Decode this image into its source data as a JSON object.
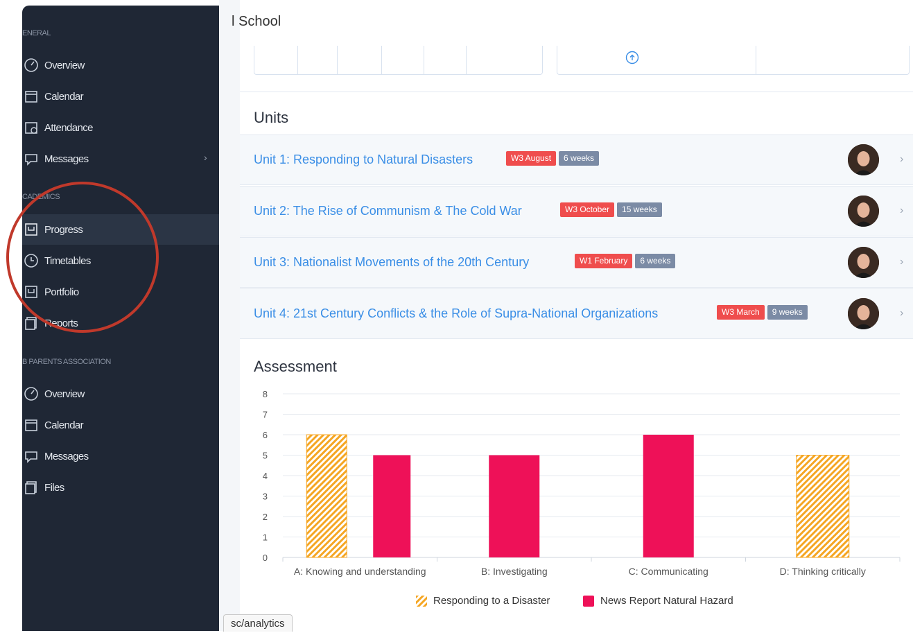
{
  "header": {
    "school_name": "l School"
  },
  "sidebar": {
    "sections": [
      {
        "label": "ENERAL"
      },
      {
        "label": "CADEMICS"
      },
      {
        "label": "B PARENTS ASSOCIATION"
      }
    ],
    "items": [
      {
        "label": "Overview",
        "icon": "overview-icon"
      },
      {
        "label": "Calendar",
        "icon": "calendar-icon"
      },
      {
        "label": "Attendance",
        "icon": "attendance-icon"
      },
      {
        "label": "Messages",
        "icon": "messages-icon"
      },
      {
        "label": "Progress",
        "icon": "progress-icon"
      },
      {
        "label": "Timetables",
        "icon": "clock-icon"
      },
      {
        "label": "Portfolio",
        "icon": "portfolio-icon"
      },
      {
        "label": "Reports",
        "icon": "reports-icon"
      },
      {
        "label": "Overview",
        "icon": "overview-icon"
      },
      {
        "label": "Calendar",
        "icon": "calendar-icon"
      },
      {
        "label": "Messages",
        "icon": "messages-icon"
      },
      {
        "label": "Files",
        "icon": "files-icon"
      }
    ],
    "active_item": "Progress",
    "messages_chevron": "›"
  },
  "units": {
    "heading": "Units",
    "items": [
      {
        "title": "Unit 1: Responding to Natural Disasters",
        "start": "W3 August",
        "duration": "6 weeks"
      },
      {
        "title": "Unit 2: The Rise of Communism & The Cold War",
        "start": "W3 October",
        "duration": "15 weeks"
      },
      {
        "title": "Unit 3: Nationalist Movements of the 20th Century",
        "start": "W1 February",
        "duration": "6 weeks"
      },
      {
        "title": "Unit 4: 21st Century Conflicts & the Role of Supra-National Organizations",
        "start": "W3 March",
        "duration": "9 weeks"
      }
    ],
    "chevron": "›"
  },
  "assessment": {
    "heading": "Assessment"
  },
  "chart_data": {
    "type": "bar",
    "title": "",
    "xlabel": "",
    "ylabel": "",
    "ylim": [
      0,
      8
    ],
    "yticks": [
      0,
      1,
      2,
      3,
      4,
      5,
      6,
      7,
      8
    ],
    "categories": [
      "A: Knowing and understanding",
      "B: Investigating",
      "C: Communicating",
      "D: Thinking critically"
    ],
    "series": [
      {
        "name": "Responding to a Disaster",
        "values": [
          6,
          null,
          null,
          5
        ],
        "color": "#f5a623",
        "pattern": "diagonal-stripes"
      },
      {
        "name": "News Report Natural Hazard",
        "values": [
          5,
          5,
          6,
          null
        ],
        "color": "#ee1158",
        "pattern": "solid"
      }
    ],
    "grid": true,
    "legend": "bottom"
  },
  "status_bar": {
    "url": "sc/analytics"
  },
  "colors": {
    "sidebar_bg": "#1f2735",
    "link_blue": "#3a8ee6",
    "tag_red": "#ef4d4d",
    "tag_gray": "#7b8ba5",
    "annotation_circle": "#c0392b"
  }
}
